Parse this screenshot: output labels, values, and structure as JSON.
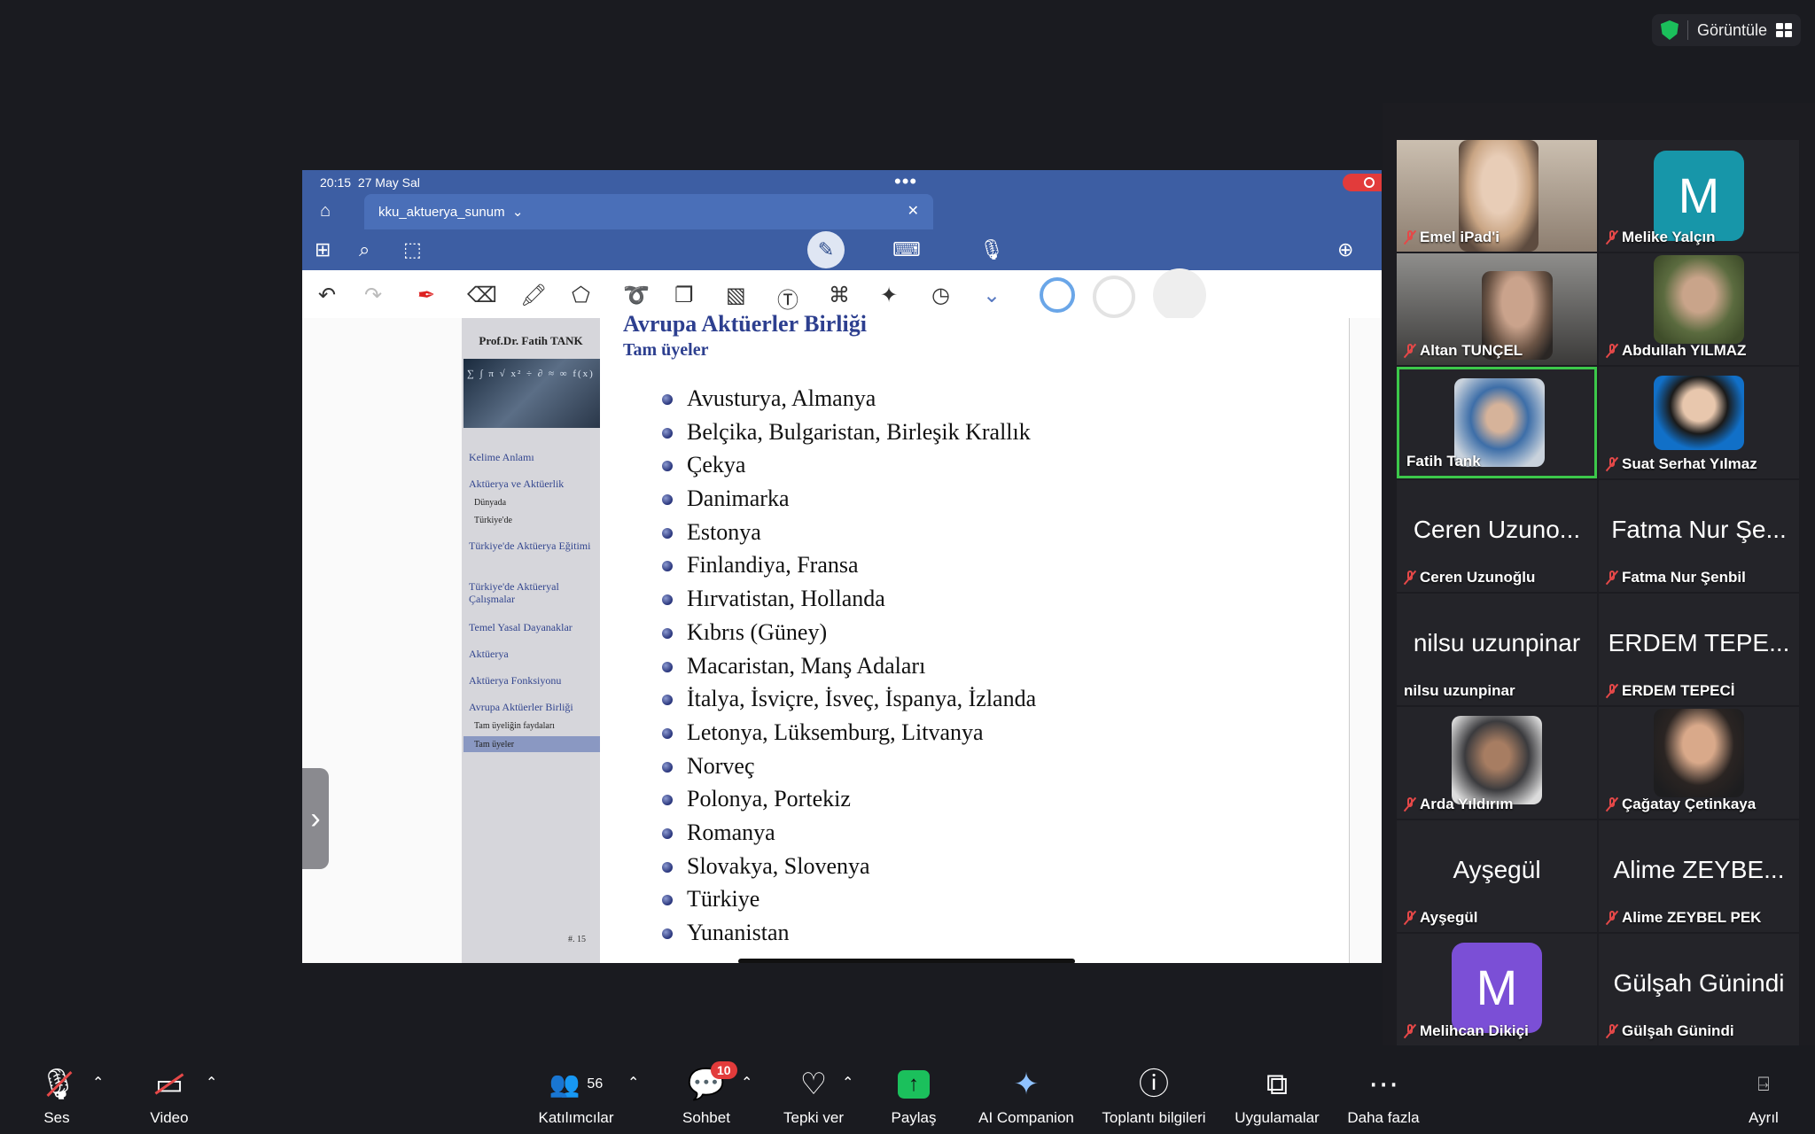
{
  "window": {
    "view_label": "Görüntüle"
  },
  "share": {
    "status_time": "20:15",
    "status_date": "27 May Sal",
    "doc_tab": "kku_aktuerya_sunum",
    "slide": {
      "author": "Prof.Dr. Fatih TANK",
      "title": "Avrupa Aktüerler Birliği",
      "subtitle": "Tam üyeler",
      "items": [
        "Avusturya, Almanya",
        "Belçika, Bulgaristan, Birleşik Krallık",
        "Çekya",
        "Danimarka",
        "Estonya",
        "Finlandiya, Fransa",
        "Hırvatistan, Hollanda",
        "Kıbrıs (Güney)",
        "Macaristan, Manş Adaları",
        "İtalya, İsviçre, İsveç, İspanya, İzlanda",
        "Letonya, Lüksemburg, Litvanya",
        "Norveç",
        "Polonya, Portekiz",
        "Romanya",
        "Slovakya, Slovenya",
        "Türkiye",
        "Yunanistan"
      ],
      "nav": [
        {
          "label": "Kelime Anlamı"
        },
        {
          "label": "Aktüerya ve Aktüerlik"
        },
        {
          "label": "Dünyada"
        },
        {
          "label": "Türkiye'de"
        },
        {
          "label": "Türkiye'de Aktüerya Eğitimi"
        },
        {
          "label": "Türkiye'de Aktüeryal Çalışmalar"
        },
        {
          "label": "Temel Yasal Dayanaklar"
        },
        {
          "label": "Aktüerya"
        },
        {
          "label": "Aktüerya Fonksiyonu"
        },
        {
          "label": "Avrupa Aktüerler Birliği"
        },
        {
          "label": "Tam üyeliğin faydaları"
        },
        {
          "label": "Tam üyeler"
        }
      ],
      "page_number": "#. 15"
    }
  },
  "participants": [
    {
      "name": "Emel iPad'i"
    },
    {
      "name": "Melike Yalçın",
      "initial": "M"
    },
    {
      "name": "Altan TUNÇEL"
    },
    {
      "name": "Abdullah YILMAZ"
    },
    {
      "name": "Fatih Tank"
    },
    {
      "name": "Suat Serhat Yılmaz"
    },
    {
      "name": "Ceren Uzunoğlu",
      "display": "Ceren Uzuno..."
    },
    {
      "name": "Fatma Nur Şenbil",
      "display": "Fatma Nur Şe..."
    },
    {
      "name": "nilsu uzunpinar",
      "display": "nilsu uzunpinar"
    },
    {
      "name": "ERDEM TEPECİ",
      "display": "ERDEM TEPE..."
    },
    {
      "name": "Arda Yıldırım"
    },
    {
      "name": "Çağatay Çetinkaya"
    },
    {
      "name": "Ayşegül",
      "display": "Ayşegül"
    },
    {
      "name": "Alime ZEYBEL PEK",
      "display": "Alime ZEYBE..."
    },
    {
      "name": "Melihcan Dikiçi",
      "initial": "M"
    },
    {
      "name": "Gülşah Günindi",
      "display": "Gülşah Günindi"
    }
  ],
  "bottombar": {
    "audio": "Ses",
    "video": "Video",
    "participants": "Katılımcılar",
    "participants_count": "56",
    "chat": "Sohbet",
    "chat_badge": "10",
    "react": "Tepki ver",
    "share": "Paylaş",
    "ai": "AI Companion",
    "info": "Toplantı bilgileri",
    "apps": "Uygulamalar",
    "more": "Daha fazla",
    "leave": "Ayrıl"
  },
  "colors": {
    "accent": "#3d5ea3",
    "active_speaker": "#3cc84a",
    "share_green": "#1bc05c",
    "mute_red": "#e54848"
  }
}
